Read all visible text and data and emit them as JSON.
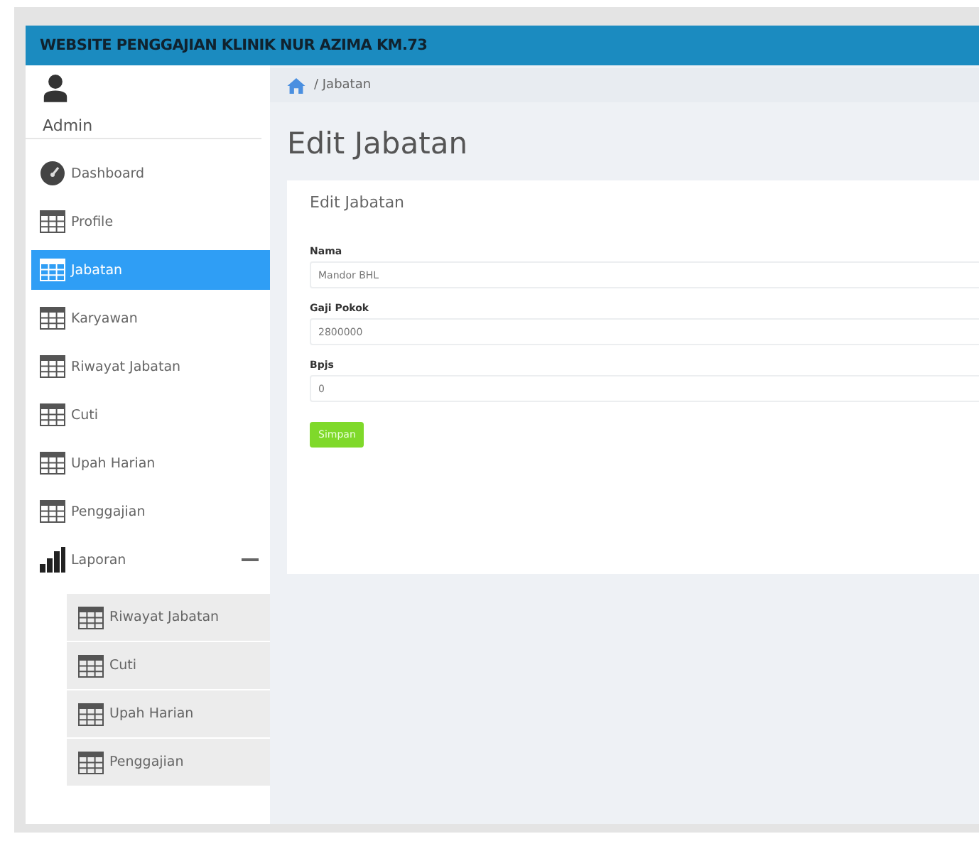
{
  "header": {
    "title": "WEBSITE PENGGAJIAN KLINIK NUR AZIMA KM.73"
  },
  "user": {
    "name": "Admin"
  },
  "sidebar": {
    "items": [
      {
        "kind": "gauge",
        "label": "Dashboard",
        "selected": false
      },
      {
        "kind": "table",
        "label": "Profile",
        "selected": false
      },
      {
        "kind": "table",
        "label": "Jabatan",
        "selected": true
      },
      {
        "kind": "table",
        "label": "Karyawan",
        "selected": false
      },
      {
        "kind": "table",
        "label": "Riwayat Jabatan",
        "selected": false
      },
      {
        "kind": "table",
        "label": "Cuti",
        "selected": false
      },
      {
        "kind": "table",
        "label": "Upah Harian",
        "selected": false
      },
      {
        "kind": "table",
        "label": "Penggajian",
        "selected": false
      },
      {
        "kind": "bars",
        "label": "Laporan",
        "selected": false,
        "expanded": true,
        "children": [
          {
            "kind": "table",
            "label": "Riwayat Jabatan",
            "selected": false
          },
          {
            "kind": "table",
            "label": "Cuti",
            "selected": false
          },
          {
            "kind": "table",
            "label": "Upah Harian",
            "selected": false
          },
          {
            "kind": "table",
            "label": "Penggajian",
            "selected": false
          }
        ]
      }
    ]
  },
  "breadcrumb": {
    "path": "/ Jabatan"
  },
  "page_title": "Edit Jabatan",
  "form": {
    "title": "Edit Jabatan",
    "fields": [
      {
        "label": "Nama",
        "value": "Mandor BHL"
      },
      {
        "label": "Gaji Pokok",
        "value": "2800000"
      },
      {
        "label": "Bpjs",
        "value": "0"
      }
    ],
    "submit": "Simpan"
  }
}
